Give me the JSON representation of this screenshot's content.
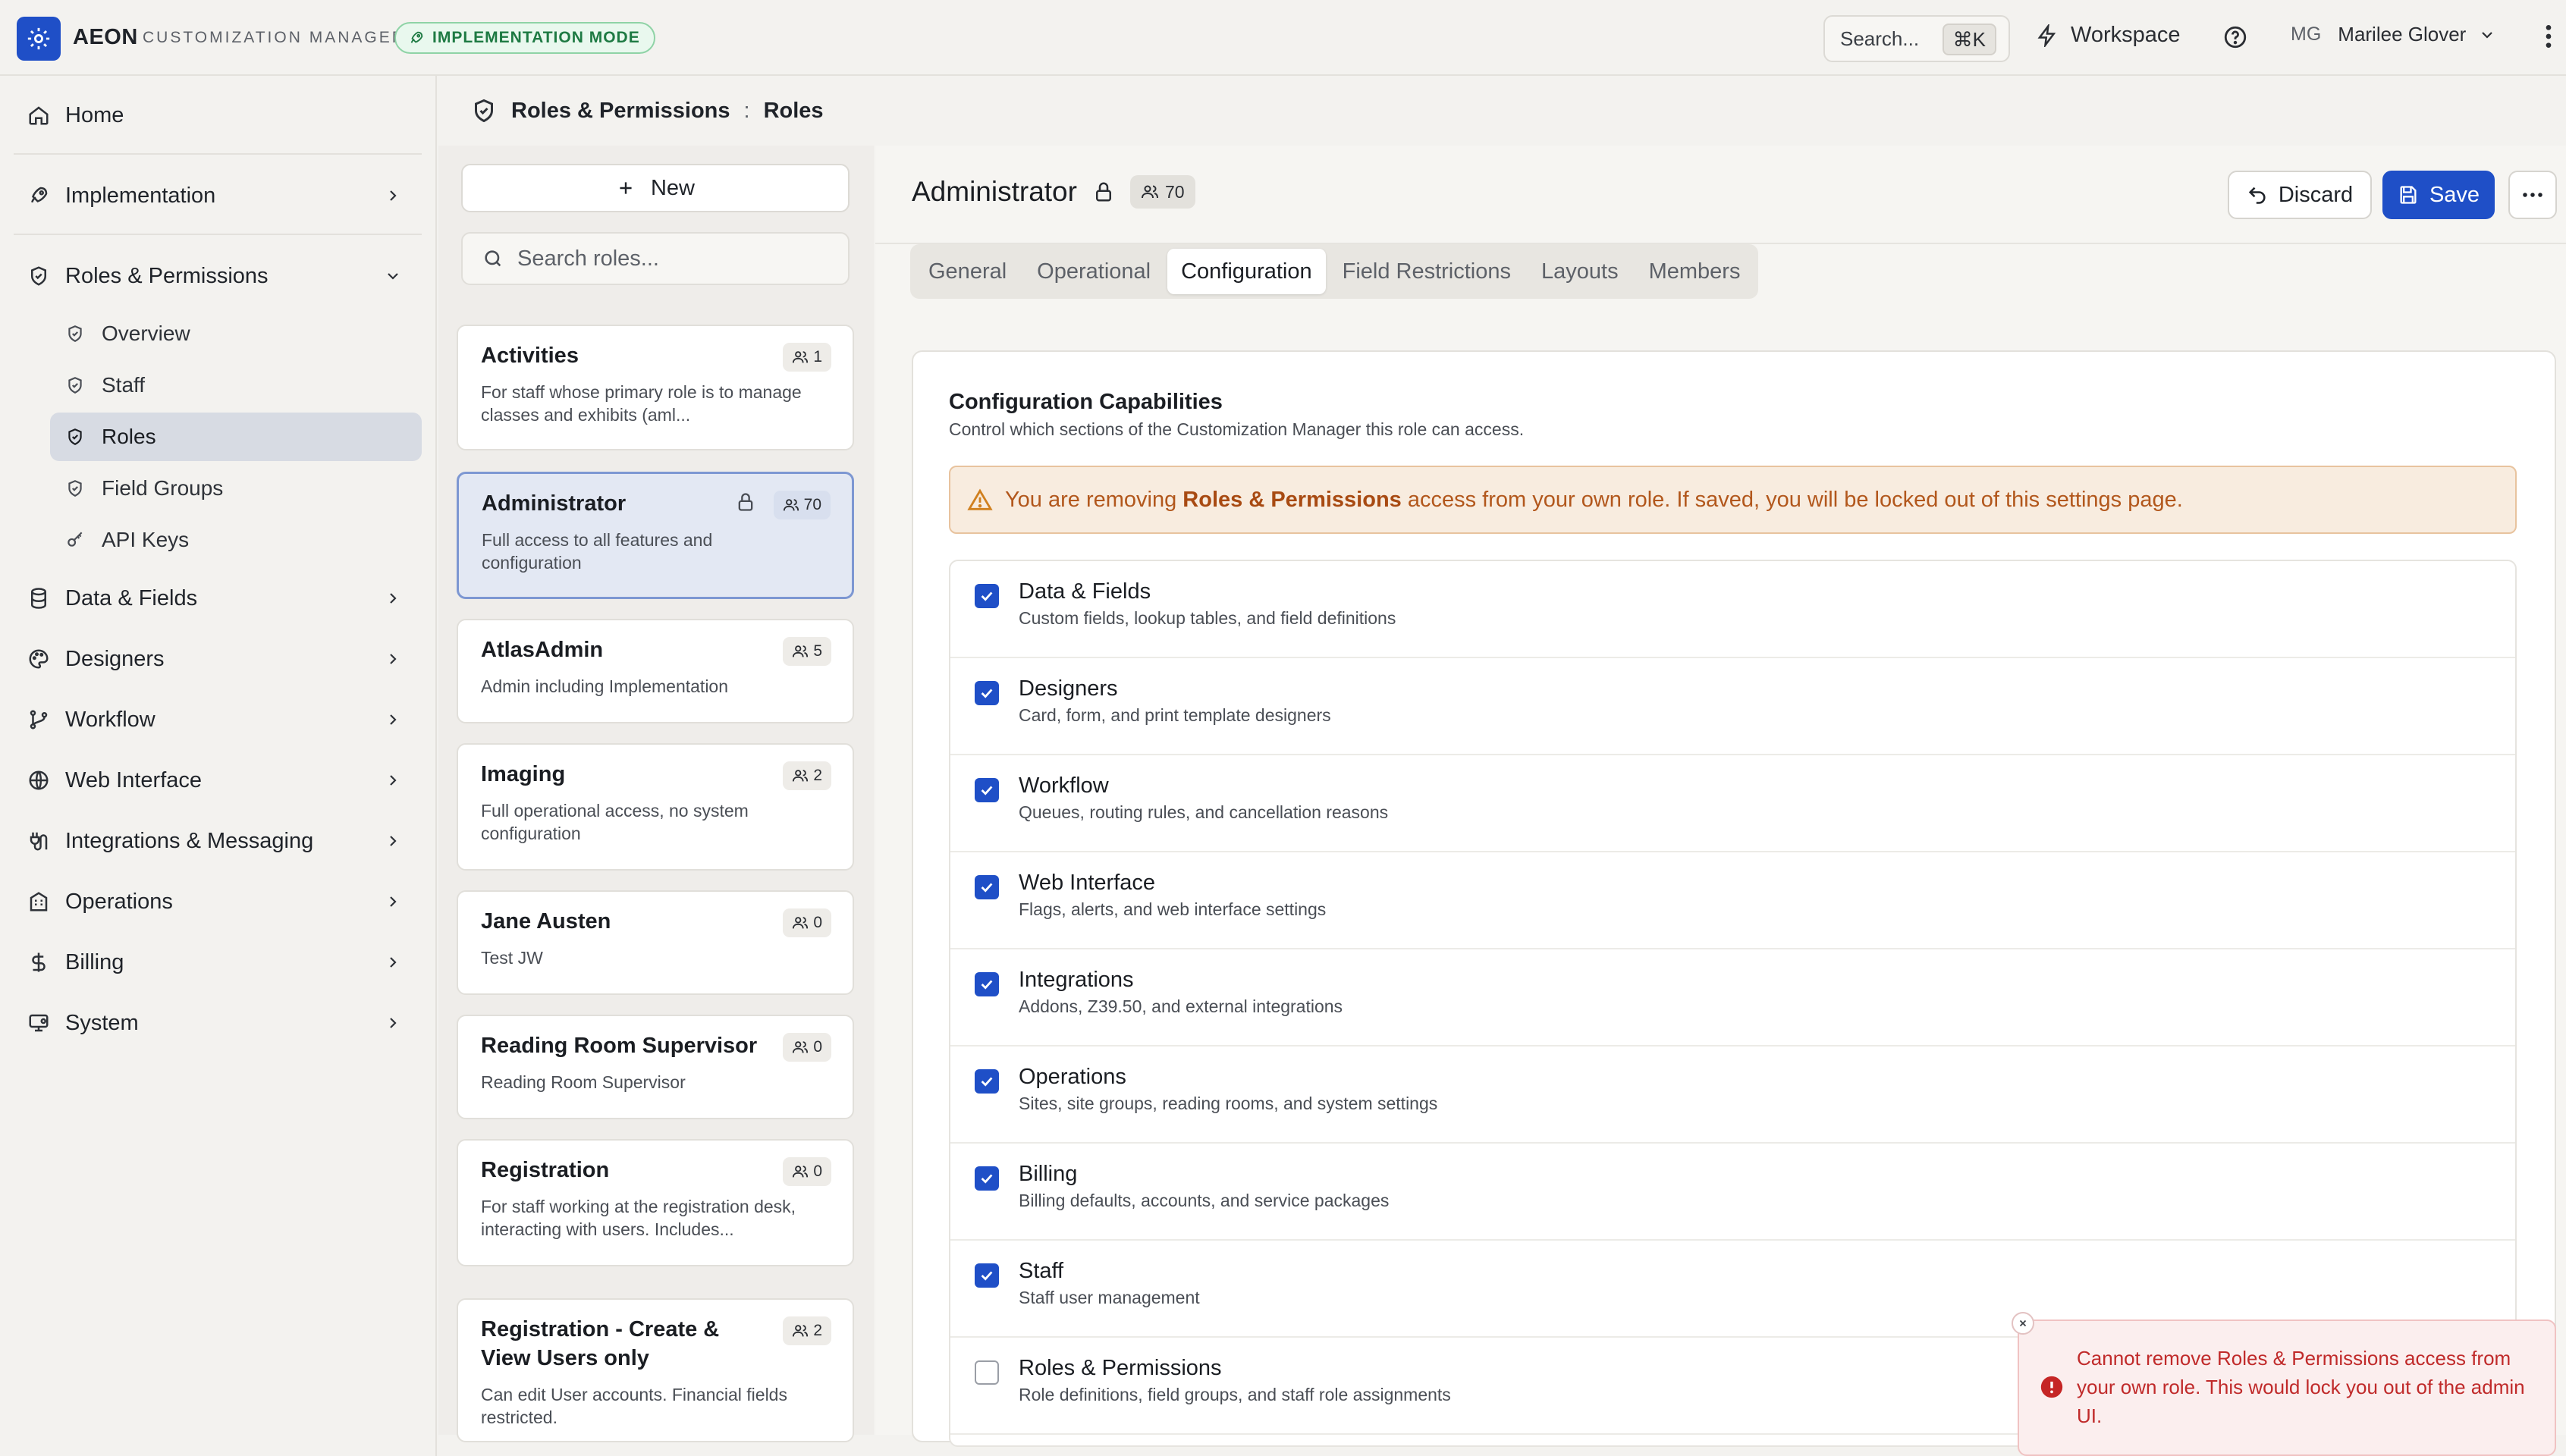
{
  "app": {
    "brand": "AEON",
    "subtitle": "CUSTOMIZATION MANAGER",
    "mode_badge": "IMPLEMENTATION MODE"
  },
  "topbar": {
    "search_label": "Search...",
    "search_shortcut": "⌘K",
    "workspace_label": "Workspace",
    "user_initials": "MG",
    "user_name": "Marilee Glover"
  },
  "sidebar": {
    "home": "Home",
    "implementation": "Implementation",
    "roles_permissions": "Roles & Permissions",
    "sub": [
      "Overview",
      "Staff",
      "Roles",
      "Field Groups",
      "API Keys"
    ],
    "data_fields": "Data & Fields",
    "designers": "Designers",
    "workflow": "Workflow",
    "web_interface": "Web Interface",
    "integrations_messaging": "Integrations & Messaging",
    "operations": "Operations",
    "billing": "Billing",
    "system": "System"
  },
  "breadcrumb": {
    "section": "Roles & Permissions",
    "separator": ":",
    "page": "Roles"
  },
  "roles_panel": {
    "new_label": "New",
    "search_placeholder": "Search roles...",
    "roles": [
      {
        "title": "Activities",
        "count": "1",
        "desc": "For staff whose primary role is to manage classes and exhibits (aml..."
      },
      {
        "title": "Administrator",
        "count": "70",
        "desc": "Full access to all features and configuration"
      },
      {
        "title": "AtlasAdmin",
        "count": "5",
        "desc": "Admin including Implementation"
      },
      {
        "title": "Imaging",
        "count": "2",
        "desc": "Full operational access, no system configuration"
      },
      {
        "title": "Jane Austen",
        "count": "0",
        "desc": "Test JW"
      },
      {
        "title": "Reading Room Supervisor",
        "count": "0",
        "desc": "Reading Room Supervisor"
      },
      {
        "title": "Registration",
        "count": "0",
        "desc": "For staff working at the registration desk, interacting with users. Includes..."
      },
      {
        "title": "Registration - Create & View Users only",
        "count": "2",
        "desc": "Can edit User accounts. Financial fields restricted."
      }
    ]
  },
  "detail": {
    "title": "Administrator",
    "member_count": "70",
    "discard_label": "Discard",
    "save_label": "Save",
    "tabs": [
      "General",
      "Operational",
      "Configuration",
      "Field Restrictions",
      "Layouts",
      "Members"
    ],
    "active_tab": "Configuration"
  },
  "config": {
    "title": "Configuration Capabilities",
    "subtitle": "Control which sections of the Customization Manager this role can access.",
    "warning_pre": "You are removing ",
    "warning_bold": "Roles & Permissions",
    "warning_post": " access from your own role. If saved, you will be locked out of this settings page.",
    "capabilities": [
      {
        "label": "Data & Fields",
        "desc": "Custom fields, lookup tables, and field definitions",
        "checked": true
      },
      {
        "label": "Designers",
        "desc": "Card, form, and print template designers",
        "checked": true
      },
      {
        "label": "Workflow",
        "desc": "Queues, routing rules, and cancellation reasons",
        "checked": true
      },
      {
        "label": "Web Interface",
        "desc": "Flags, alerts, and web interface settings",
        "checked": true
      },
      {
        "label": "Integrations",
        "desc": "Addons, Z39.50, and external integrations",
        "checked": true
      },
      {
        "label": "Operations",
        "desc": "Sites, site groups, reading rooms, and system settings",
        "checked": true
      },
      {
        "label": "Billing",
        "desc": "Billing defaults, accounts, and service packages",
        "checked": true
      },
      {
        "label": "Staff",
        "desc": "Staff user management",
        "checked": true
      },
      {
        "label": "Roles & Permissions",
        "desc": "Role definitions, field groups, and staff role assignments",
        "checked": false
      }
    ]
  },
  "toast": {
    "message": "Cannot remove Roles & Permissions access from your own role. This would lock you out of the admin UI."
  },
  "colors": {
    "accent": "#1f4fc7",
    "warning_bg": "#f8ecdf",
    "warning_text": "#b2571c",
    "error_text": "#c02a2a",
    "success_badge": "#1e7a43"
  }
}
